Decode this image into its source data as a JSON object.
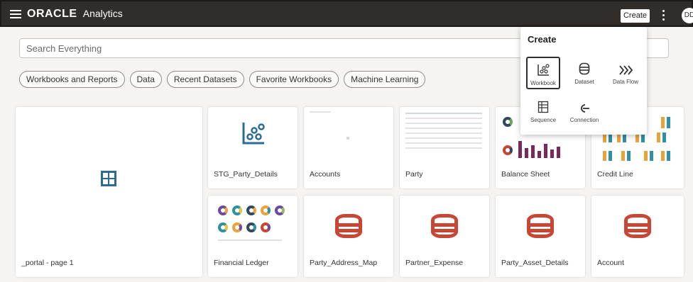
{
  "header": {
    "logo_text": "ORACLE",
    "app_name": "Analytics",
    "create_label": "Create",
    "avatar_initials": "DD"
  },
  "search": {
    "placeholder": "Search Everything"
  },
  "filters": [
    "Workbooks and Reports",
    "Data",
    "Recent Datasets",
    "Favorite Workbooks",
    "Machine Learning"
  ],
  "cards": [
    {
      "label": "_portal - page 1",
      "kind": "portal"
    },
    {
      "label": "STG_Party_Details",
      "kind": "workbook"
    },
    {
      "label": "Accounts",
      "kind": "workbook-thumb"
    },
    {
      "label": "Party",
      "kind": "table-thumb"
    },
    {
      "label": "Balance Sheet",
      "kind": "chart-thumb"
    },
    {
      "label": "Credit Line",
      "kind": "bar-thumb"
    },
    {
      "label": "Financial Ledger",
      "kind": "donut-thumb"
    },
    {
      "label": "Party_Address_Map",
      "kind": "dataset"
    },
    {
      "label": "Partner_Expense",
      "kind": "dataset"
    },
    {
      "label": "Party_Asset_Details",
      "kind": "dataset"
    },
    {
      "label": "Account",
      "kind": "dataset"
    }
  ],
  "create_menu": {
    "title": "Create",
    "items": [
      {
        "label": "Workbook",
        "icon": "workbook-icon",
        "selected": true
      },
      {
        "label": "Dataset",
        "icon": "dataset-icon"
      },
      {
        "label": "Data Flow",
        "icon": "data-flow-icon"
      },
      {
        "label": "Sequence",
        "icon": "sequence-icon"
      },
      {
        "label": "Connection",
        "icon": "connection-icon"
      }
    ]
  },
  "colors": {
    "header_bg": "#312d2a",
    "dataset_red": "#c74634",
    "workbook_blue": "#2c6b93"
  }
}
